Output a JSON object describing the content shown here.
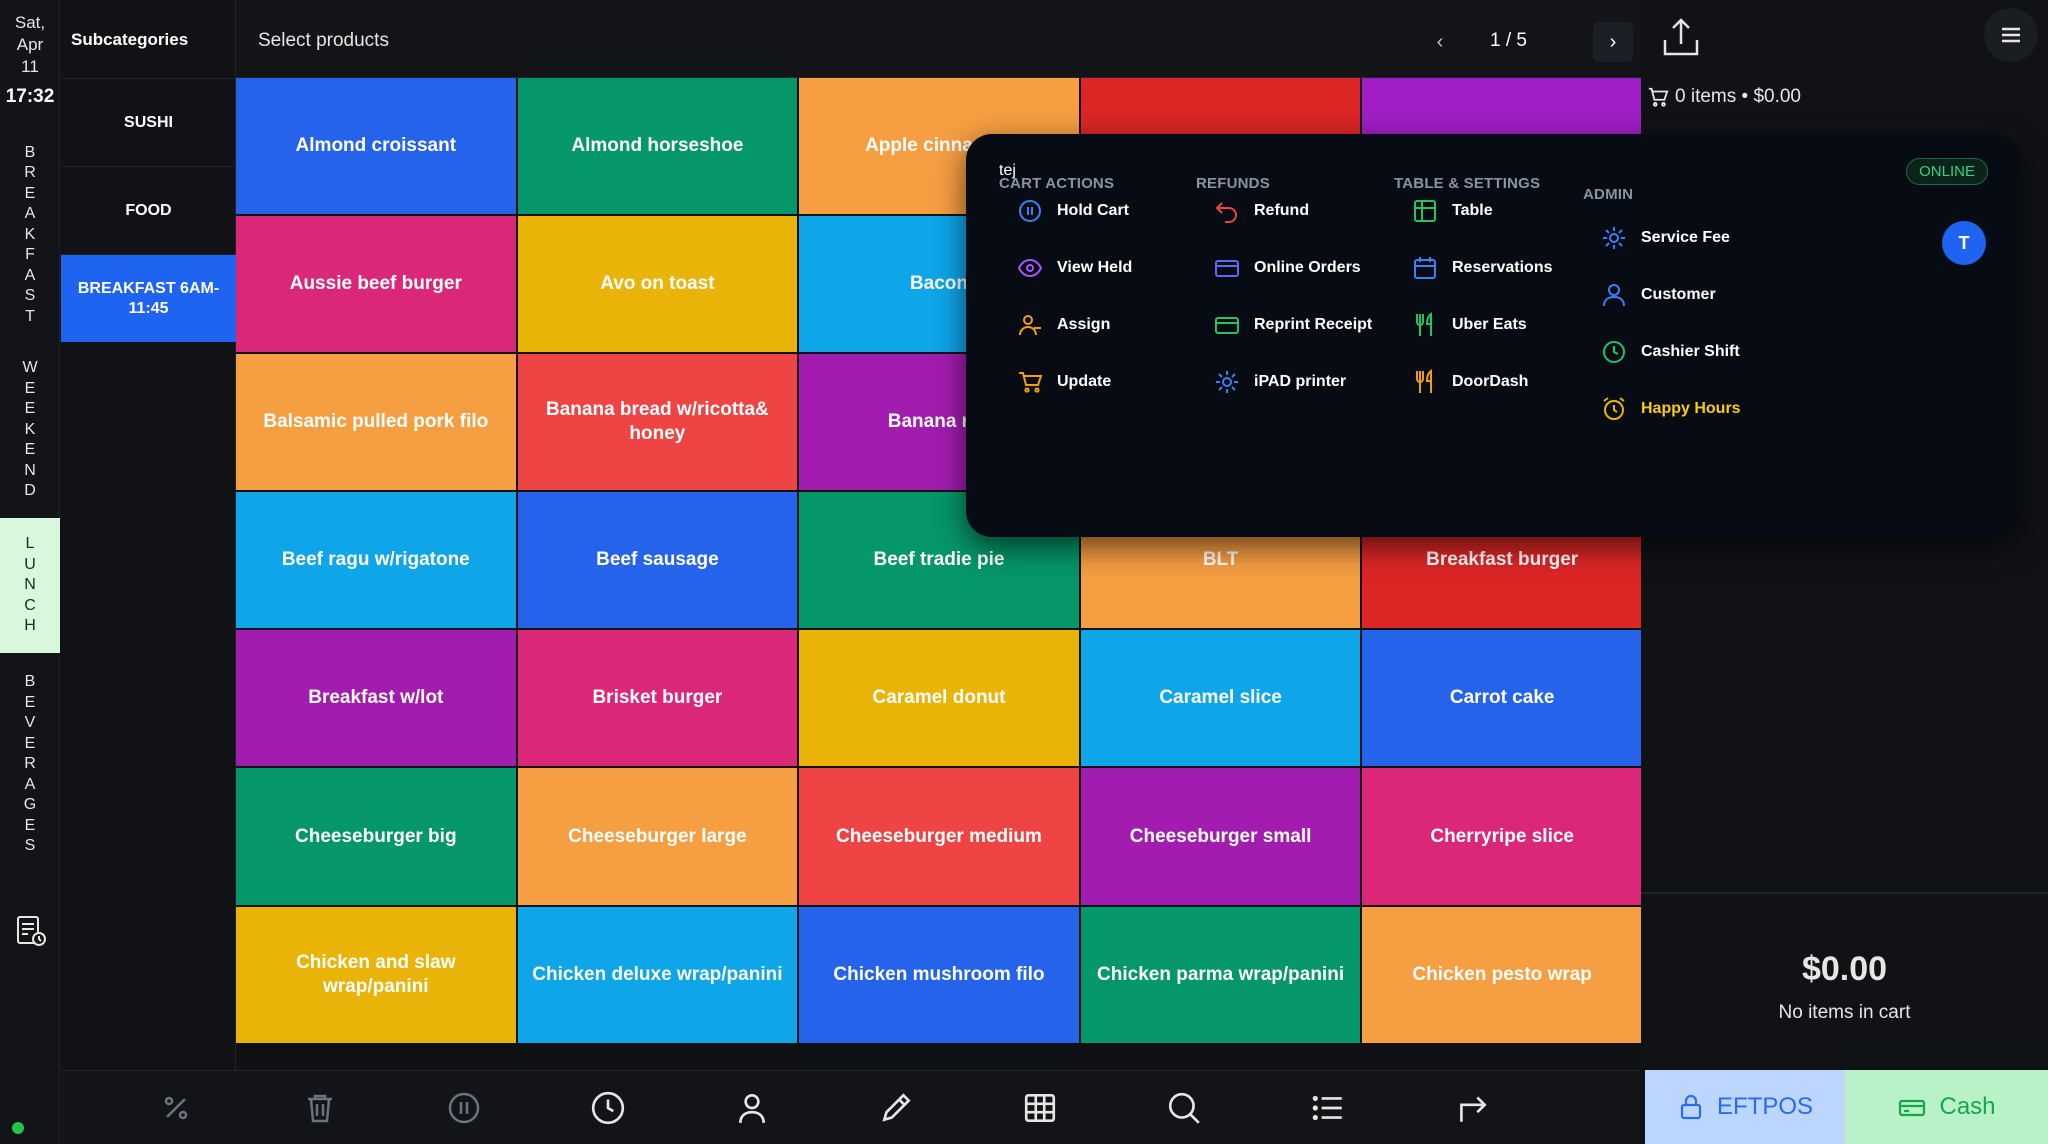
{
  "rail": {
    "date_lines": [
      "Sat,",
      "Apr",
      "11"
    ],
    "time": "17:32",
    "categories": [
      {
        "label": "BREAKFAST",
        "active": false
      },
      {
        "label": "WEEKEND",
        "active": false
      },
      {
        "label": "LUNCH",
        "active": true
      },
      {
        "label": "BEVERAGES",
        "active": false
      }
    ],
    "status": "online"
  },
  "subcategories": {
    "title": "Subcategories",
    "items": [
      {
        "label": "SUSHI",
        "active": false
      },
      {
        "label": "FOOD",
        "active": false
      },
      {
        "label": "BREAKFAST 6AM-11:45",
        "active": true
      }
    ]
  },
  "header": {
    "title": "Select products",
    "prev": "‹",
    "next": "›",
    "page": "1 / 5"
  },
  "products": [
    {
      "name": "Almond croissant",
      "color": "#2563eb"
    },
    {
      "name": "Almond horseshoe",
      "color": "#059669"
    },
    {
      "name": "Apple cinnamon",
      "color": "#f59e42"
    },
    {
      "name": "",
      "color": "#dc2626"
    },
    {
      "name": "",
      "color": "#9f1fc4"
    },
    {
      "name": "Aussie beef burger",
      "color": "#db2777"
    },
    {
      "name": "Avo on toast",
      "color": "#eab308"
    },
    {
      "name": "Bacon",
      "color": "#0ea5e9"
    },
    {
      "name": "",
      "color": "#0ea5e9"
    },
    {
      "name": "",
      "color": "#0ea5e9"
    },
    {
      "name": "Balsamic pulled pork filo",
      "color": "#f59e42"
    },
    {
      "name": "Banana bread w/ricotta& honey",
      "color": "#ef4444"
    },
    {
      "name": "Banana mu",
      "color": "#a21caf"
    },
    {
      "name": "",
      "color": "#a21caf"
    },
    {
      "name": "",
      "color": "#a21caf"
    },
    {
      "name": "Beef ragu w/rigatone",
      "color": "#0ea5e9"
    },
    {
      "name": "Beef sausage",
      "color": "#2563eb"
    },
    {
      "name": "Beef tradie pie",
      "color": "#059669"
    },
    {
      "name": "BLT",
      "color": "#f59e42"
    },
    {
      "name": "Breakfast burger",
      "color": "#dc2626"
    },
    {
      "name": "Breakfast w/lot",
      "color": "#a21caf"
    },
    {
      "name": "Brisket burger",
      "color": "#db2777"
    },
    {
      "name": "Caramel donut",
      "color": "#eab308"
    },
    {
      "name": "Caramel slice",
      "color": "#0ea5e9"
    },
    {
      "name": "Carrot cake",
      "color": "#2563eb"
    },
    {
      "name": "Cheeseburger big",
      "color": "#059669"
    },
    {
      "name": "Cheeseburger large",
      "color": "#f59e42"
    },
    {
      "name": "Cheeseburger medium",
      "color": "#ef4444"
    },
    {
      "name": "Cheeseburger small",
      "color": "#a21caf"
    },
    {
      "name": "Cherryripe slice",
      "color": "#db2777"
    },
    {
      "name": "Chicken and slaw wrap/panini",
      "color": "#eab308"
    },
    {
      "name": "Chicken deluxe wrap/panini",
      "color": "#0ea5e9"
    },
    {
      "name": "Chicken mushroom filo",
      "color": "#2563eb"
    },
    {
      "name": "Chicken parma wrap/panini",
      "color": "#059669"
    },
    {
      "name": "Chicken pesto wrap",
      "color": "#f59e42"
    }
  ],
  "toolbar": {
    "icons": [
      "percent-icon",
      "trash-icon",
      "pause-icon",
      "clock-icon",
      "user-icon",
      "pencil-icon",
      "table-icon",
      "search-icon",
      "list-icon",
      "redirect-icon"
    ]
  },
  "cart": {
    "summary": "0 items • $0.00",
    "total": "$0.00",
    "empty_text": "No items in cart",
    "eftpos_label": "EFTPOS",
    "cash_label": "Cash"
  },
  "popup": {
    "user": "tej",
    "status": "ONLINE",
    "avatar_initial": "T",
    "columns": [
      {
        "title": "CART ACTIONS",
        "items": [
          {
            "label": "Hold Cart",
            "icon": "pause-circle-icon",
            "color": "#3b82f6"
          },
          {
            "label": "View Held",
            "icon": "eye-icon",
            "color": "#a855f7"
          },
          {
            "label": "Assign",
            "icon": "user-assign-icon",
            "color": "#f59e0b"
          },
          {
            "label": "Update",
            "icon": "cart-icon",
            "color": "#f59e0b"
          }
        ]
      },
      {
        "title": "REFUNDS",
        "items": [
          {
            "label": "Refund",
            "icon": "undo-icon",
            "color": "#ef4444"
          },
          {
            "label": "Online Orders",
            "icon": "card-icon",
            "color": "#6366f1"
          },
          {
            "label": "Reprint Receipt",
            "icon": "card-icon",
            "color": "#22c55e"
          },
          {
            "label": "iPAD printer",
            "icon": "gear-icon",
            "color": "#3b82f6"
          }
        ]
      },
      {
        "title": "TABLE & SETTINGS",
        "items": [
          {
            "label": "Table",
            "icon": "table-icon",
            "color": "#22c55e"
          },
          {
            "label": "Reservations",
            "icon": "calendar-icon",
            "color": "#3b82f6"
          },
          {
            "label": "Uber Eats",
            "icon": "utensils-icon",
            "color": "#22c55e"
          },
          {
            "label": "DoorDash",
            "icon": "utensils-icon",
            "color": "#f59e0b"
          }
        ]
      },
      {
        "title": "ADMIN",
        "items": [
          {
            "label": "Service Fee",
            "icon": "gear-icon",
            "color": "#3b82f6"
          },
          {
            "label": "Customer",
            "icon": "user-icon",
            "color": "#3b82f6"
          },
          {
            "label": "Cashier Shift",
            "icon": "clock-icon",
            "color": "#22c55e"
          },
          {
            "label": "Happy Hours",
            "icon": "alarm-icon",
            "color": "#eab308"
          }
        ]
      }
    ]
  },
  "colors": {
    "accent": "#1e64f0",
    "online": "#35d18b",
    "active_tab": "#d8f7dc"
  }
}
